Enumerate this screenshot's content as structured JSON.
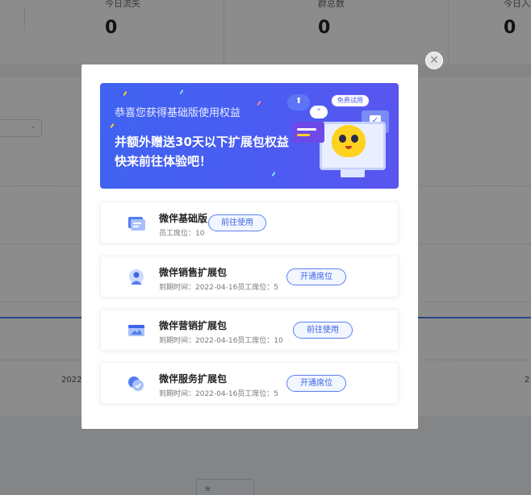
{
  "background": {
    "stats": [
      {
        "label": "今日流失",
        "value": "0"
      },
      {
        "label": "群总数",
        "value": "0"
      },
      {
        "label": "今日入群",
        "value": "0"
      }
    ],
    "axis_label_1": "2022-",
    "axis_label_2": "2"
  },
  "modal": {
    "close_glyph": "✕",
    "banner": {
      "line1": "恭喜您获得基础版使用权益",
      "line2": "并额外赠送30天以下扩展包权益",
      "line3": "快来前往体验吧！",
      "free_tag": "免费试用",
      "quote": "“",
      "check": "✓"
    },
    "packages": [
      {
        "name": "微伴基础版",
        "sub": "员工席位：10",
        "button": "前往使用",
        "icon": "id-card-icon"
      },
      {
        "name": "微伴销售扩展包",
        "sub": "到期时间：2022-04-16员工席位：5",
        "button": "开通席位",
        "icon": "sales-person-icon"
      },
      {
        "name": "微伴营销扩展包",
        "sub": "到期时间：2022-04-16员工席位：10",
        "button": "前往使用",
        "icon": "marketing-window-icon"
      },
      {
        "name": "微伴服务扩展包",
        "sub": "到期时间：2022-04-16员工席位：5",
        "button": "开通席位",
        "icon": "service-chat-icon"
      }
    ]
  },
  "colors": {
    "accent": "#3d63e8",
    "banner_start": "#3f63f0",
    "banner_end": "#5a55ef",
    "mascot": "#ffd21f"
  }
}
